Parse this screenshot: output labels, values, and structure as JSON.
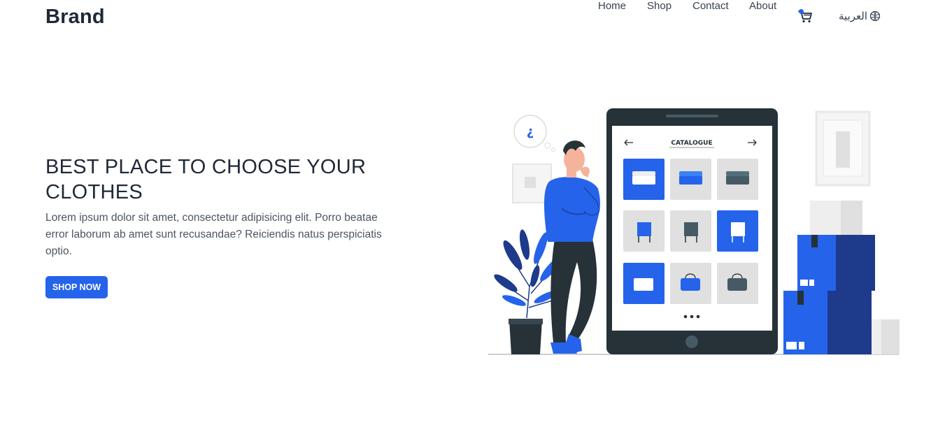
{
  "navbar": {
    "brand": "Brand",
    "links": [
      "Home",
      "Shop",
      "Contact",
      "About"
    ],
    "cart_icon": "cart-icon",
    "language_label": "العربية",
    "language_icon": "globe-icon"
  },
  "hero": {
    "title": "BEST PLACE TO CHOOSE YOUR CLOTHES",
    "description": "Lorem ipsum dolor sit amet, consectetur adipisicing elit. Porro beatae error laborum ab amet sunt recusandae? Reiciendis natus perspiciatis optio.",
    "button_label": "SHOP NOW"
  },
  "illustration": {
    "catalogue_label": "CATALOGUE",
    "thought_symbol": "¿",
    "dots": "•••"
  },
  "colors": {
    "accent": "#2563eb",
    "dark_text": "#1f2937",
    "body_text": "#4b5563",
    "tablet": "#263238",
    "box_dark": "#1e3a8a"
  }
}
